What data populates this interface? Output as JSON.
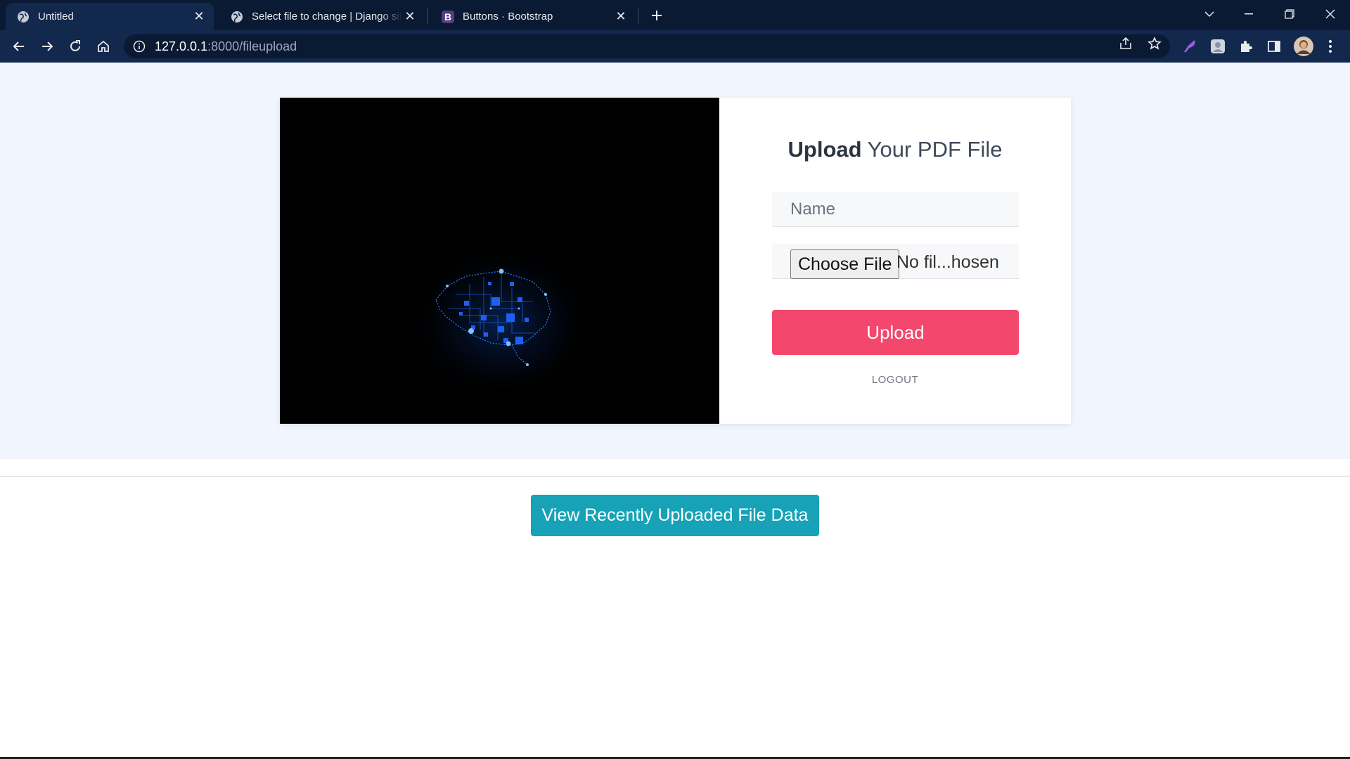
{
  "browser": {
    "tabs": [
      {
        "title": "Untitled",
        "active": true,
        "icon": "globe-icon"
      },
      {
        "title": "Select file to change | Django site admin",
        "active": false,
        "icon": "globe-icon"
      },
      {
        "title": "Buttons · Bootstrap",
        "active": false,
        "icon": "bootstrap-icon"
      }
    ],
    "favicon_b": "B",
    "url_host": "127.0.0.1",
    "url_rest": ":8000/fileupload"
  },
  "page": {
    "title_bold": "Upload",
    "title_rest": " Your PDF File",
    "name_placeholder": "Name",
    "choose_file_label": "Choose File",
    "file_status": "No fil...hosen",
    "upload_label": "Upload",
    "logout_label": "LOGOUT",
    "view_button_label": "View Recently Uploaded File Data"
  },
  "colors": {
    "upload_button": "#f3476d",
    "view_button": "#17a2b8",
    "hero_background": "#f1f5fd",
    "browser_frame": "#0b1a33"
  }
}
